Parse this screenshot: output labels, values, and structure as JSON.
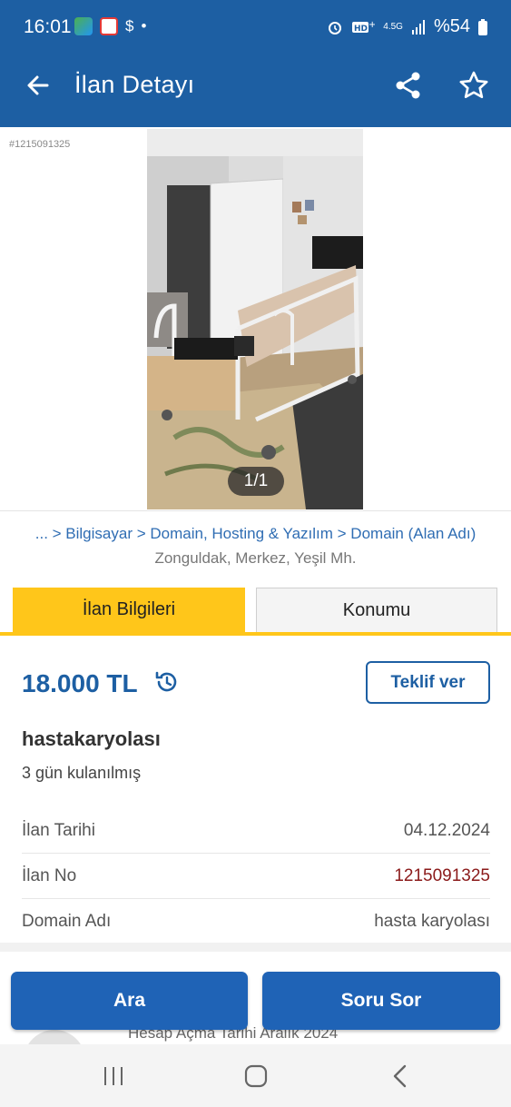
{
  "status_bar": {
    "time": "16:01",
    "dollar": "$",
    "dot": "•",
    "network": "4.5G",
    "battery": "%54"
  },
  "app_bar": {
    "title": "İlan Detayı",
    "icons": [
      "back-arrow-icon",
      "share-icon",
      "star-icon"
    ]
  },
  "gallery": {
    "ad_hash": "#1215091325",
    "counter": "1/1"
  },
  "breadcrumb": {
    "path": "... > Bilgisayar > Domain, Hosting & Yazılım > Domain (Alan Adı)",
    "location": "Zonguldak, Merkez, Yeşil Mh."
  },
  "tabs": [
    {
      "label": "İlan Bilgileri",
      "active": true
    },
    {
      "label": "Konumu",
      "active": false
    }
  ],
  "listing": {
    "price": "18.000 TL",
    "offer_button": "Teklif ver",
    "title": "hastakaryolası",
    "description": "3 gün kulanılmış",
    "details": [
      {
        "key": "İlan Tarihi",
        "value": "04.12.2024"
      },
      {
        "key": "İlan No",
        "value": "1215091325"
      },
      {
        "key": "Domain Adı",
        "value": "hasta karyolası"
      }
    ]
  },
  "seller": {
    "meta": "Hesap Açma Tarihi Aralık 2024"
  },
  "actions": {
    "call": "Ara",
    "ask": "Soru Sor"
  },
  "colors": {
    "brand_blue": "#1d5fa3",
    "accent_yellow": "#ffc61a",
    "ad_number_red": "#8b1a1a"
  }
}
